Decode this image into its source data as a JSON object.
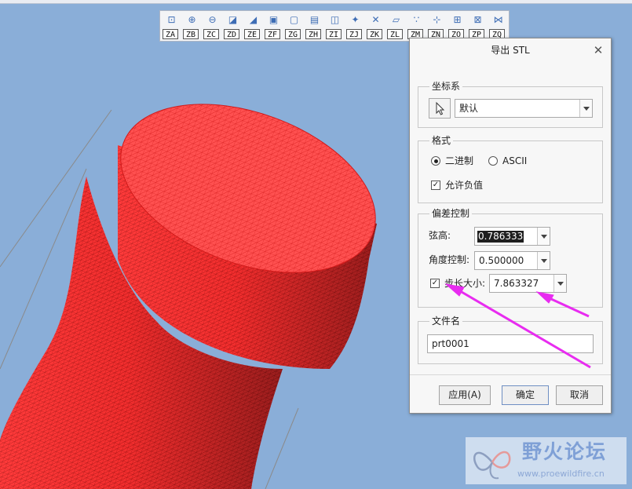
{
  "toolbar": {
    "buttons": [
      {
        "key": "ZA",
        "icon": "zoom-fit-icon",
        "glyph": "⊡"
      },
      {
        "key": "ZB",
        "icon": "zoom-in-icon",
        "glyph": "⊕"
      },
      {
        "key": "ZC",
        "icon": "zoom-out-icon",
        "glyph": "⊖"
      },
      {
        "key": "ZD",
        "icon": "repaint-icon",
        "glyph": "◪"
      },
      {
        "key": "ZE",
        "icon": "shading-icon",
        "glyph": "◢"
      },
      {
        "key": "ZF",
        "icon": "shaded-edges-icon",
        "glyph": "▣"
      },
      {
        "key": "ZG",
        "icon": "wireframe-icon",
        "glyph": "▢"
      },
      {
        "key": "ZH",
        "icon": "saved-views-icon",
        "glyph": "▤"
      },
      {
        "key": "ZI",
        "icon": "view-manager-icon",
        "glyph": "◫"
      },
      {
        "key": "ZJ",
        "icon": "datum-display-icon",
        "glyph": "✦"
      },
      {
        "key": "ZK",
        "icon": "axis-display-icon",
        "glyph": "✕"
      },
      {
        "key": "ZL",
        "icon": "plane-display-icon",
        "glyph": "▱"
      },
      {
        "key": "ZM",
        "icon": "point-display-icon",
        "glyph": "∵"
      },
      {
        "key": "ZN",
        "icon": "csys-display-icon",
        "glyph": "⊹"
      },
      {
        "key": "ZO",
        "icon": "annotation-display-icon",
        "glyph": "⊞"
      },
      {
        "key": "ZP",
        "icon": "spin-center-icon",
        "glyph": "⊠"
      },
      {
        "key": "ZQ",
        "icon": "sketch-display-icon",
        "glyph": "⋈"
      }
    ]
  },
  "dialog": {
    "title": "导出 STL",
    "close_icon": "close-icon",
    "csys": {
      "label": "坐标系",
      "select_icon": "cursor-arrow-icon",
      "value": "默认"
    },
    "format": {
      "label": "格式",
      "binary_label": "二进制",
      "ascii_label": "ASCII",
      "selected": "二进制",
      "allow_negative_label": "允许负值",
      "allow_negative_checked": true
    },
    "deviation": {
      "label": "偏差控制",
      "chord_label": "弦高:",
      "chord_value": "0.786333",
      "angle_label": "角度控制:",
      "angle_value": "0.500000",
      "step_label": "步长大小:",
      "step_checked": true,
      "step_value": "7.863327"
    },
    "filename": {
      "label": "文件名",
      "value": "prt0001"
    },
    "buttons": {
      "apply": "应用(A)",
      "ok": "确定",
      "cancel": "取消"
    }
  },
  "watermark": {
    "title": "野火论坛",
    "url": "www.proewildfire.cn"
  },
  "colors": {
    "background": "#8aaed8",
    "mesh": "#ff2a2a",
    "annotation": "#e82cf0"
  }
}
